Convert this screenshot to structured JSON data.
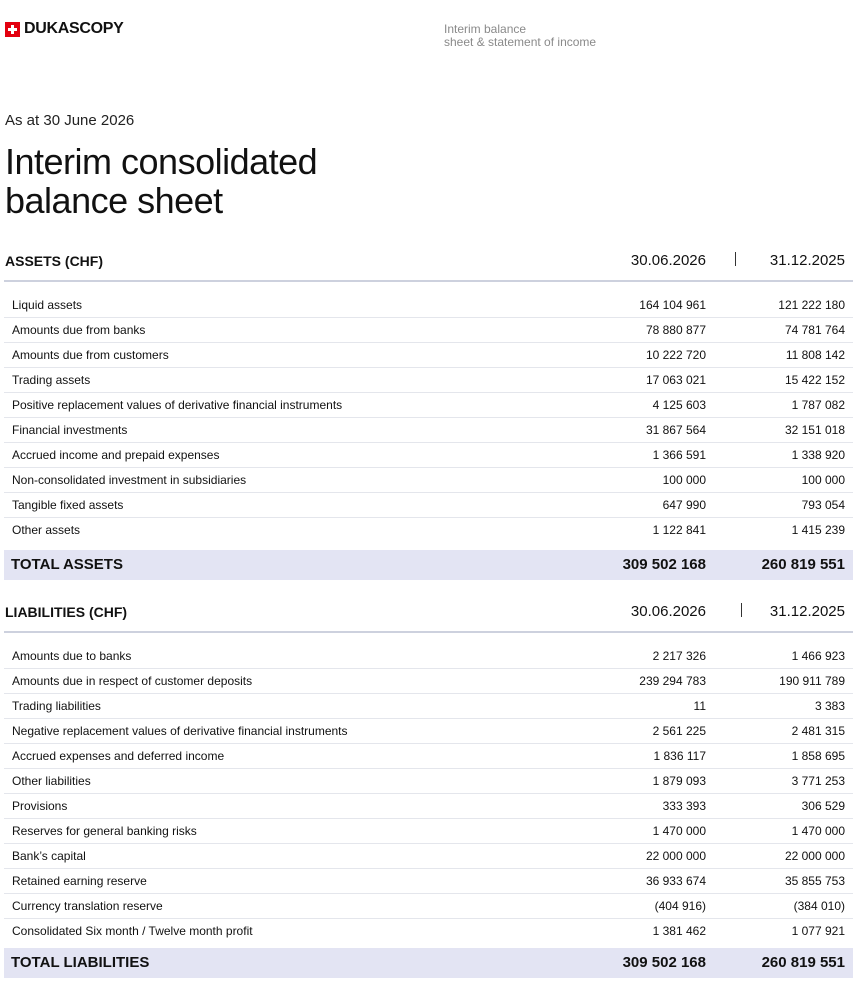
{
  "brand": {
    "name": "DUKASCOPY",
    "accent_color": "#e3000f"
  },
  "header": {
    "subtitle_line1": "Interim balance",
    "subtitle_line2": "sheet & statement of income"
  },
  "document": {
    "as_at": "As at 30 June 2026",
    "title_line1": "Interim consolidated",
    "title_line2": "balance sheet"
  },
  "assets": {
    "heading": "ASSETS (CHF)",
    "col1": "30.06.2026",
    "col2": "31.12.2025",
    "rows": [
      {
        "label": "Liquid assets",
        "v1": "164 104 961",
        "v2": "121 222 180"
      },
      {
        "label": "Amounts due from banks",
        "v1": "78 880 877",
        "v2": "74 781 764"
      },
      {
        "label": "Amounts due from customers",
        "v1": "10 222 720",
        "v2": "11 808 142"
      },
      {
        "label": "Trading assets",
        "v1": "17 063 021",
        "v2": "15 422 152"
      },
      {
        "label": "Positive replacement values of derivative financial instruments",
        "v1": "4 125 603",
        "v2": "1 787 082"
      },
      {
        "label": "Financial investments",
        "v1": "31 867 564",
        "v2": "32 151 018"
      },
      {
        "label": "Accrued income and prepaid expenses",
        "v1": "1 366 591",
        "v2": "1 338 920"
      },
      {
        "label": "Non-consolidated investment in subsidiaries",
        "v1": "100 000",
        "v2": "100 000"
      },
      {
        "label": "Tangible fixed assets",
        "v1": "647 990",
        "v2": "793 054"
      },
      {
        "label": "Other assets",
        "v1": "1 122 841",
        "v2": "1 415 239"
      }
    ],
    "total": {
      "label": "TOTAL ASSETS",
      "v1": "309 502 168",
      "v2": "260 819 551"
    }
  },
  "liabilities": {
    "heading": "LIABILITIES (CHF)",
    "col1": "30.06.2026",
    "col2": "31.12.2025",
    "rows": [
      {
        "label": "Amounts due to banks",
        "v1": "2 217 326",
        "v2": "1 466 923"
      },
      {
        "label": "Amounts due in respect of customer deposits",
        "v1": "239 294 783",
        "v2": "190 911 789"
      },
      {
        "label": "Trading liabilities",
        "v1": "11",
        "v2": "3 383"
      },
      {
        "label": "Negative replacement values of derivative financial instruments",
        "v1": "2 561 225",
        "v2": "2 481 315"
      },
      {
        "label": "Accrued expenses and deferred income",
        "v1": "1 836 117",
        "v2": "1 858 695"
      },
      {
        "label": "Other liabilities",
        "v1": "1 879 093",
        "v2": "3 771 253"
      },
      {
        "label": "Provisions",
        "v1": "333 393",
        "v2": "306 529"
      },
      {
        "label": "Reserves for general banking risks",
        "v1": "1 470 000",
        "v2": "1 470 000"
      },
      {
        "label": "Bank’s capital",
        "v1": "22 000 000",
        "v2": "22 000 000"
      },
      {
        "label": "Retained earning reserve",
        "v1": "36 933 674",
        "v2": "35 855 753"
      },
      {
        "label": "Currency translation reserve",
        "v1": "(404 916)",
        "v2": "(384 010)"
      },
      {
        "label": "Consolidated Six month / Twelve month profit",
        "v1": "1 381 462",
        "v2": "1 077 921"
      }
    ],
    "total": {
      "label": "TOTAL LIABILITIES",
      "v1": "309 502 168",
      "v2": "260 819 551"
    }
  }
}
